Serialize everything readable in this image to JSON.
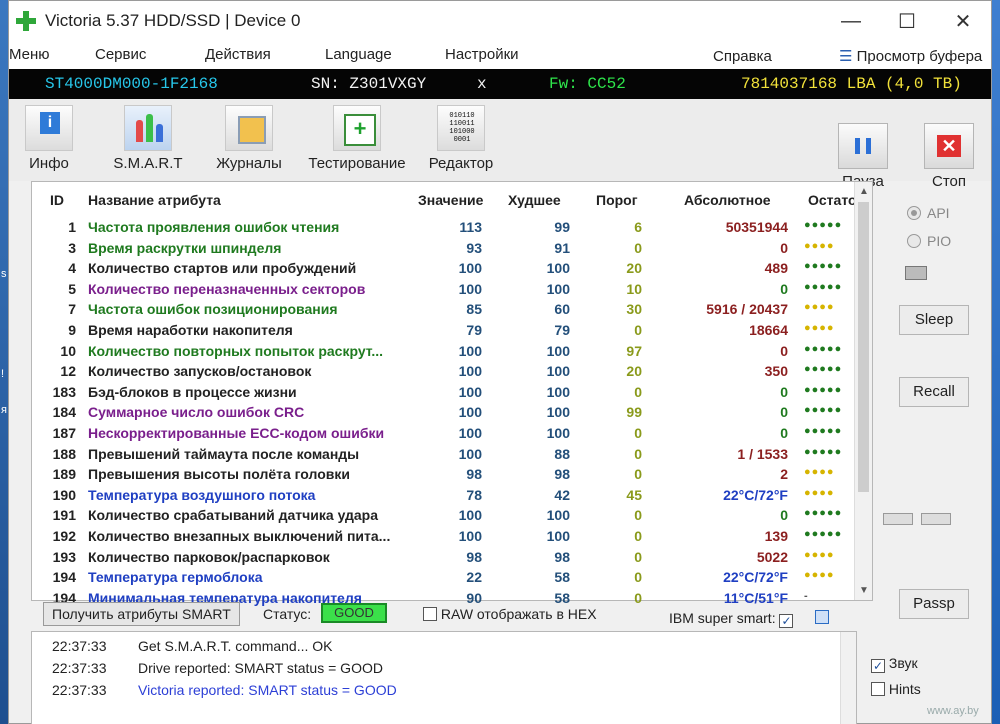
{
  "desktop": {
    "left_texts": [
      "s",
      "!",
      "я"
    ]
  },
  "window": {
    "title": "Victoria 5.37 HDD/SSD | Device 0",
    "minimize": "—",
    "maximize": "☐",
    "close": "✕"
  },
  "menu": [
    "Меню",
    "Сервис",
    "Действия",
    "Language",
    "Настройки",
    "Справка"
  ],
  "buffer_view": "Просмотр буфера",
  "drive": {
    "model": "ST4000DM000-1F2168",
    "serial": "SN: Z301VXGY",
    "close": "x",
    "firmware": "Fw: CC52",
    "capacity": "7814037168 LBA (4,0 TB)"
  },
  "toolbar": {
    "info": "Инфо",
    "smart": "S.M.A.R.T",
    "logs": "Журналы",
    "testing": "Тестирование",
    "editor": "Редактор",
    "pause": "Пауза",
    "stop": "Стоп"
  },
  "table": {
    "headers": {
      "id": "ID",
      "name": "Название атрибута",
      "value": "Значение",
      "worst": "Худшее",
      "threshold": "Порог",
      "absolute": "Абсолютное",
      "remaining": "Остаток"
    },
    "rows": [
      {
        "id": "1",
        "name": "Частота проявления ошибок чтения",
        "value": "113",
        "worst": "99",
        "threshold": "6",
        "absolute": "50351944",
        "dots": "●●●●●",
        "name_color": "#1f7a1f",
        "abs_color": "#8b1f1f",
        "dots_color": "#1f7a1f"
      },
      {
        "id": "3",
        "name": "Время раскрутки шпинделя",
        "value": "93",
        "worst": "91",
        "threshold": "0",
        "absolute": "0",
        "dots": "●●●●",
        "name_color": "#1f7a1f",
        "abs_color": "#8b1f1f",
        "dots_color": "#d6b400"
      },
      {
        "id": "4",
        "name": "Количество стартов или пробуждений",
        "value": "100",
        "worst": "100",
        "threshold": "20",
        "absolute": "489",
        "dots": "●●●●●",
        "name_color": "#222222",
        "abs_color": "#8b1f1f",
        "dots_color": "#1f7a1f"
      },
      {
        "id": "5",
        "name": "Количество переназначенных секторов",
        "value": "100",
        "worst": "100",
        "threshold": "10",
        "absolute": "0",
        "dots": "●●●●●",
        "name_color": "#7a1f8c",
        "abs_color": "#1f7a1f",
        "dots_color": "#1f7a1f"
      },
      {
        "id": "7",
        "name": "Частота ошибок позиционирования",
        "value": "85",
        "worst": "60",
        "threshold": "30",
        "absolute": "5916 / 20437",
        "dots": "●●●●",
        "name_color": "#1f7a1f",
        "abs_color": "#8b1f1f",
        "dots_color": "#d6b400"
      },
      {
        "id": "9",
        "name": "Время наработки накопителя",
        "value": "79",
        "worst": "79",
        "threshold": "0",
        "absolute": "18664",
        "dots": "●●●●",
        "name_color": "#222222",
        "abs_color": "#8b1f1f",
        "dots_color": "#d6b400"
      },
      {
        "id": "10",
        "name": "Количество повторных попыток раскрут...",
        "value": "100",
        "worst": "100",
        "threshold": "97",
        "absolute": "0",
        "dots": "●●●●●",
        "name_color": "#1f7a1f",
        "abs_color": "#8b1f1f",
        "dots_color": "#1f7a1f"
      },
      {
        "id": "12",
        "name": "Количество запусков/остановок",
        "value": "100",
        "worst": "100",
        "threshold": "20",
        "absolute": "350",
        "dots": "●●●●●",
        "name_color": "#222222",
        "abs_color": "#8b1f1f",
        "dots_color": "#1f7a1f"
      },
      {
        "id": "183",
        "name": "Бэд-блоков в процессе жизни",
        "value": "100",
        "worst": "100",
        "threshold": "0",
        "absolute": "0",
        "dots": "●●●●●",
        "name_color": "#222222",
        "abs_color": "#1f7a1f",
        "dots_color": "#1f7a1f"
      },
      {
        "id": "184",
        "name": "Суммарное число ошибок CRC",
        "value": "100",
        "worst": "100",
        "threshold": "99",
        "absolute": "0",
        "dots": "●●●●●",
        "name_color": "#7a1f8c",
        "abs_color": "#1f7a1f",
        "dots_color": "#1f7a1f"
      },
      {
        "id": "187",
        "name": "Нескорректированные ECC-кодом ошибки",
        "value": "100",
        "worst": "100",
        "threshold": "0",
        "absolute": "0",
        "dots": "●●●●●",
        "name_color": "#7a1f8c",
        "abs_color": "#1f7a1f",
        "dots_color": "#1f7a1f"
      },
      {
        "id": "188",
        "name": "Превышений таймаута после команды",
        "value": "100",
        "worst": "88",
        "threshold": "0",
        "absolute": "1 / 1533",
        "dots": "●●●●●",
        "name_color": "#222222",
        "abs_color": "#8b1f1f",
        "dots_color": "#1f7a1f"
      },
      {
        "id": "189",
        "name": "Превышения высоты полёта головки",
        "value": "98",
        "worst": "98",
        "threshold": "0",
        "absolute": "2",
        "dots": "●●●●",
        "name_color": "#222222",
        "abs_color": "#8b1f1f",
        "dots_color": "#d6b400"
      },
      {
        "id": "190",
        "name": "Температура воздушного потока",
        "value": "78",
        "worst": "42",
        "threshold": "45",
        "absolute": "22°C/72°F",
        "dots": "●●●●",
        "name_color": "#1f3fc2",
        "abs_color": "#1f3fc2",
        "dots_color": "#d6b400"
      },
      {
        "id": "191",
        "name": "Количество срабатываний датчика удара",
        "value": "100",
        "worst": "100",
        "threshold": "0",
        "absolute": "0",
        "dots": "●●●●●",
        "name_color": "#222222",
        "abs_color": "#1f7a1f",
        "dots_color": "#1f7a1f"
      },
      {
        "id": "192",
        "name": "Количество внезапных выключений пита...",
        "value": "100",
        "worst": "100",
        "threshold": "0",
        "absolute": "139",
        "dots": "●●●●●",
        "name_color": "#222222",
        "abs_color": "#8b1f1f",
        "dots_color": "#1f7a1f"
      },
      {
        "id": "193",
        "name": "Количество парковок/распарковок",
        "value": "98",
        "worst": "98",
        "threshold": "0",
        "absolute": "5022",
        "dots": "●●●●",
        "name_color": "#222222",
        "abs_color": "#8b1f1f",
        "dots_color": "#d6b400"
      },
      {
        "id": "194",
        "name": "Температура гермоблока",
        "value": "22",
        "worst": "58",
        "threshold": "0",
        "absolute": "22°C/72°F",
        "dots": "●●●●",
        "name_color": "#1f3fc2",
        "abs_color": "#1f3fc2",
        "dots_color": "#d6b400"
      },
      {
        "id": "194",
        "name": "Минимальная температура накопителя",
        "value": "90",
        "worst": "58",
        "threshold": "0",
        "absolute": "11°C/51°F",
        "dots": "-",
        "name_color": "#1f3fc2",
        "abs_color": "#1f3fc2",
        "dots_color": "#555555"
      }
    ]
  },
  "status": {
    "get_smart": "Получить атрибуты SMART",
    "label": "Статус:",
    "value": "GOOD",
    "raw_hex": "RAW отображать в HEX",
    "ibm": "IBM super smart:",
    "ibm_check": "✓"
  },
  "side": {
    "api": "API",
    "pio": "PIO",
    "sleep": "Sleep",
    "recall": "Recall",
    "passp": "Passp",
    "sound": "Звук",
    "sound_check": "✓",
    "hints": "Hints"
  },
  "log": [
    {
      "time": "22:37:33",
      "msg": "Get S.M.A.R.T. command... OK",
      "color": "#222222"
    },
    {
      "time": "22:37:33",
      "msg": "Drive reported: SMART status = GOOD",
      "color": "#222222"
    },
    {
      "time": "22:37:33",
      "msg": "Victoria reported: SMART status = GOOD",
      "color": "#2c3fd6"
    }
  ],
  "watermark": "www.ay.by"
}
